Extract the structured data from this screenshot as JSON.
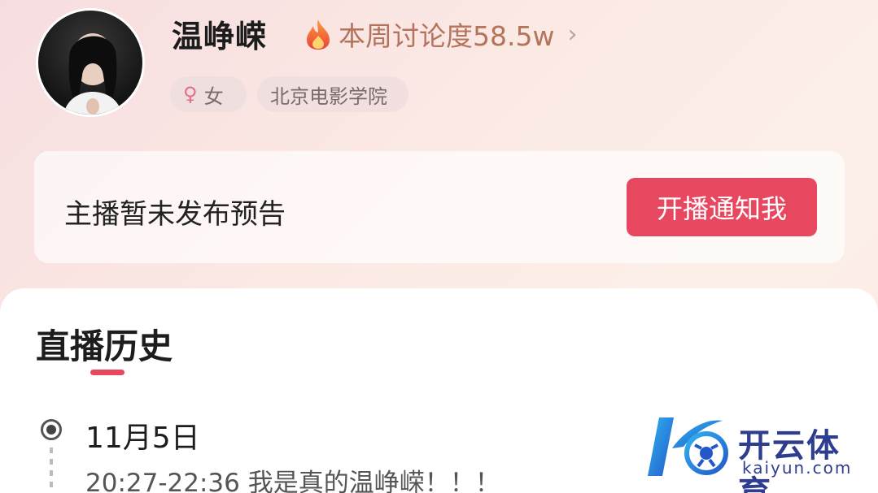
{
  "profile": {
    "name": "温峥嵘",
    "heat_label": "本周讨论度58.5w",
    "tags": [
      "女",
      "北京电影学院"
    ]
  },
  "notice": {
    "text": "主播暂未发布预告",
    "button_label": "开播通知我"
  },
  "history": {
    "title": "直播历史",
    "entries": [
      {
        "date": "11月5日",
        "session": "20:27-22:36 我是真的温峥嵘！！！"
      }
    ]
  },
  "watermark": {
    "cn": "开云体育",
    "en": "kaiyun.com"
  },
  "colors": {
    "accent": "#e7485f",
    "heat_text": "#b4745c",
    "watermark": "#2e3d8f"
  },
  "icons": {
    "heat": "flame-icon",
    "more": "chevron-right-icon",
    "gender": "female-icon",
    "timeline": "radio-dot-icon"
  }
}
